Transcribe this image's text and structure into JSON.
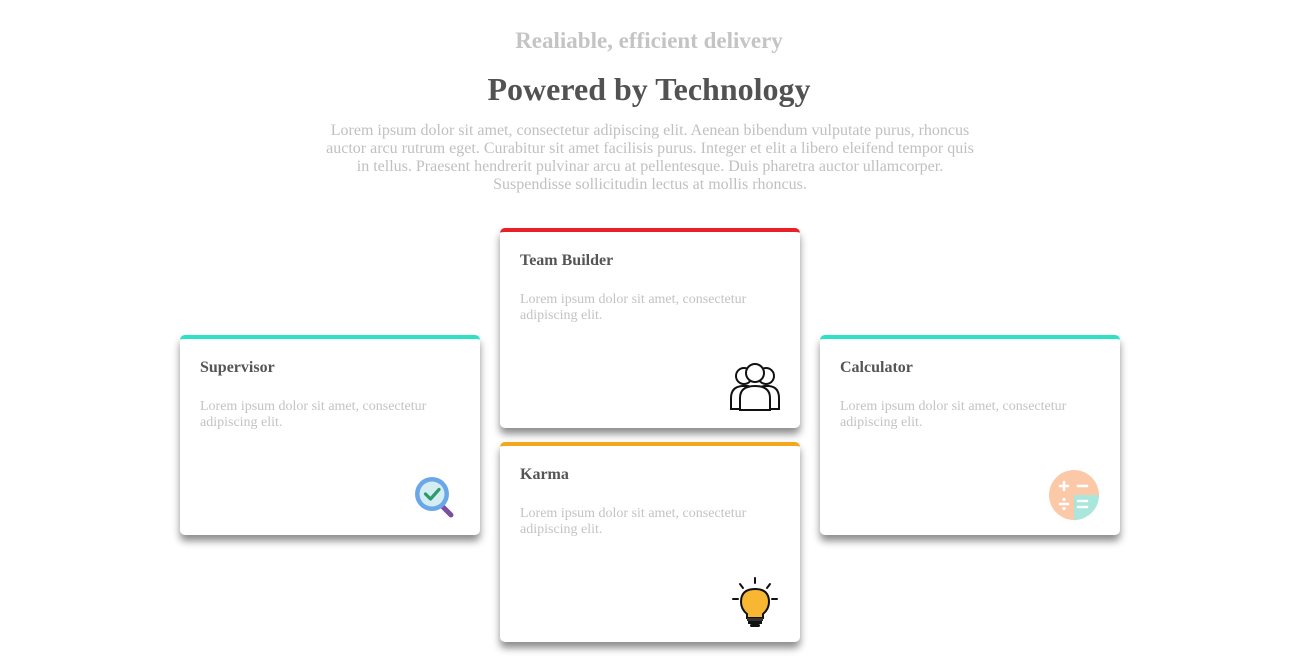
{
  "header": {
    "subtitle": "Realiable, efficient delivery",
    "title": "Powered by Technology",
    "intro": "Lorem ipsum dolor sit amet, consectetur adipiscing elit. Aenean bibendum vulputate purus, rhoncus auctor arcu rutrum eget. Curabitur sit amet facilisis purus. Integer et elit a libero eleifend tempor quis in tellus. Praesent hendrerit pulvinar arcu at pellentesque. Duis pharetra auctor ullamcorper. Suspendisse sollicitudin lectus at mollis rhoncus."
  },
  "cards": {
    "supervisor": {
      "title": "Supervisor",
      "text": "Lorem ipsum dolor sit amet, consectetur adipiscing elit.",
      "accent": "#2ee1c6",
      "icon": "magnifier-check-icon"
    },
    "team_builder": {
      "title": "Team Builder",
      "text": "Lorem ipsum dolor sit amet, consectetur adipiscing elit.",
      "accent": "#ea2027",
      "icon": "team-icon"
    },
    "karma": {
      "title": "Karma",
      "text": "Lorem ipsum dolor sit amet, consectetur adipiscing elit.",
      "accent": "#f2a81d",
      "icon": "lightbulb-icon"
    },
    "calculator": {
      "title": "Calculator",
      "text": "Lorem ipsum dolor sit amet, consectetur adipiscing elit.",
      "accent": "#2ee1c6",
      "icon": "calculator-icon"
    }
  }
}
